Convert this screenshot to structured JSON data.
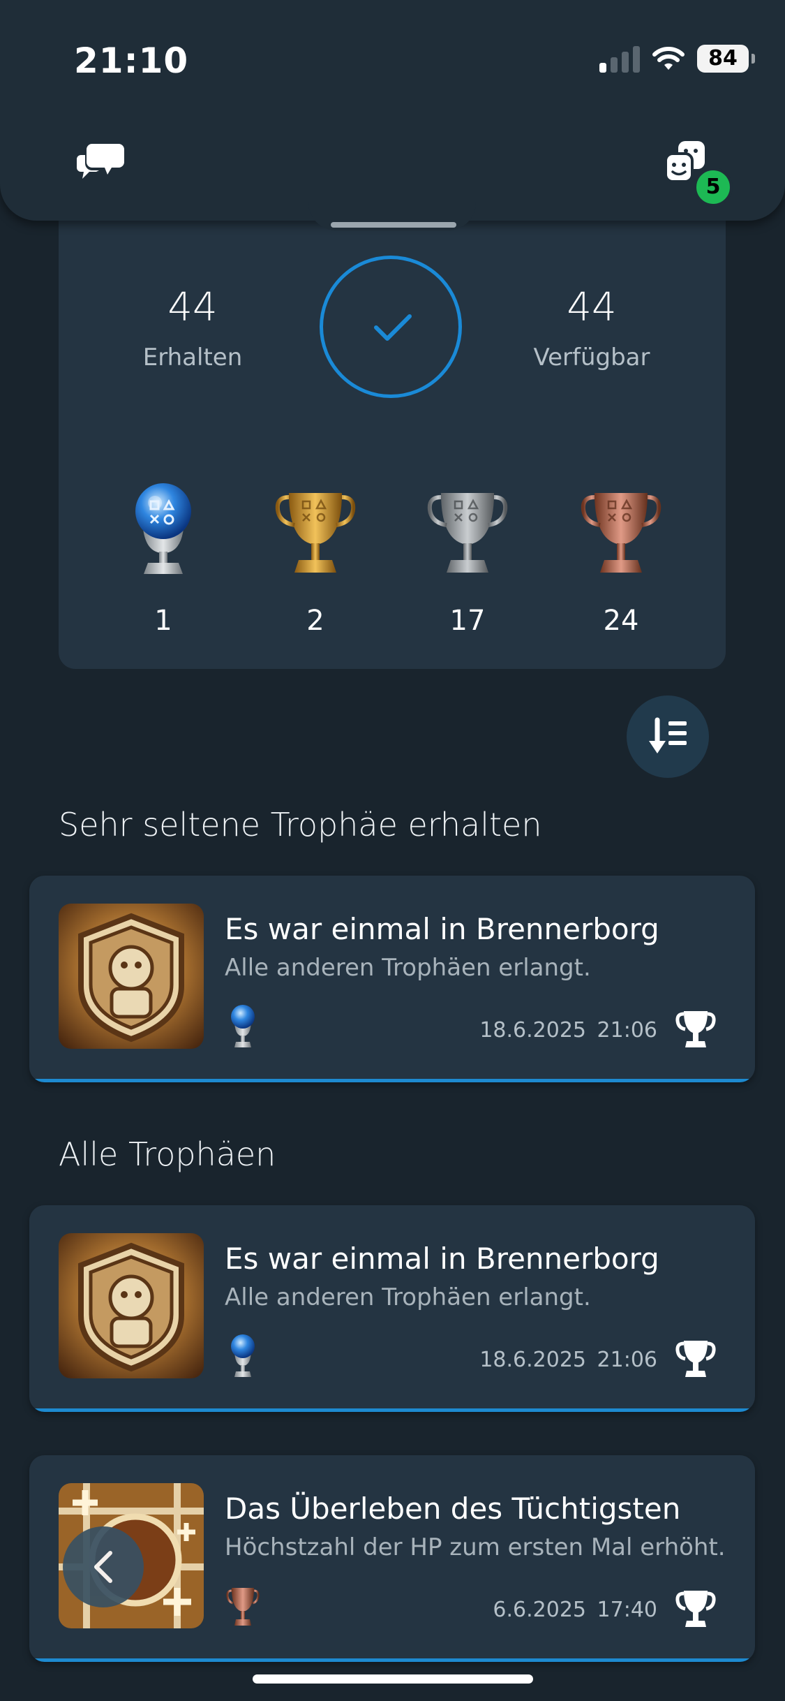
{
  "status_bar": {
    "time": "21:10",
    "battery": "84"
  },
  "header": {
    "friends_badge": "5"
  },
  "summary": {
    "earned_count": "44",
    "earned_label": "Erhalten",
    "available_count": "44",
    "available_label": "Verfügbar",
    "completion": 1.0,
    "trophies": [
      {
        "type": "platinum",
        "count": "1"
      },
      {
        "type": "gold",
        "count": "2"
      },
      {
        "type": "silver",
        "count": "17"
      },
      {
        "type": "bronze",
        "count": "24"
      }
    ]
  },
  "sections": {
    "rare_title": "Sehr seltene Trophäe erhalten",
    "all_title": "Alle Trophäen"
  },
  "rare_card": {
    "title": "Es war einmal in Brennerborg",
    "description": "Alle anderen Trophäen erlangt.",
    "grade": "platinum",
    "date": "18.6.2025 21:06"
  },
  "all_cards": [
    {
      "title": "Es war einmal in Brennerborg",
      "description": "Alle anderen Trophäen erlangt.",
      "grade": "platinum",
      "date": "18.6.2025 21:06"
    },
    {
      "title": "Das Überleben des Tüchtigsten",
      "description": "Höchstzahl der HP zum ersten Mal erhöht.",
      "grade": "bronze",
      "date": "6.6.2025 17:40"
    }
  ],
  "colors": {
    "background": "#19242d",
    "card": "#243442",
    "accent": "#1a8ad7",
    "badge": "#1db954"
  },
  "icons": {
    "chat": "chat-bubbles-icon",
    "friends": "friends-icon",
    "sort": "sort-down-icon",
    "back": "chevron-left-icon",
    "trophy": "trophy-icon"
  }
}
